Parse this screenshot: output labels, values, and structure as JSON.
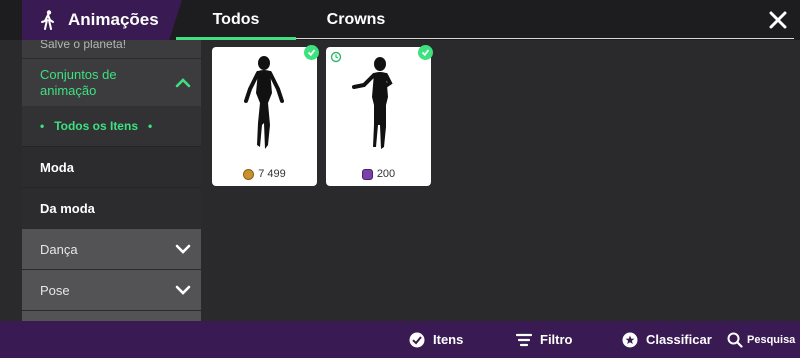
{
  "header": {
    "title": "Animações",
    "title_icon": "walking-person-icon",
    "tabs": [
      {
        "label": "Todos",
        "active": true
      },
      {
        "label": "Crowns",
        "active": false
      }
    ],
    "close_icon": "close-icon",
    "accent_color": "#3ee07f",
    "brand_color": "#3a1a52"
  },
  "sidebar": {
    "partial_top_label": "Salve o planeta!",
    "group": {
      "label": "Conjuntos de animação",
      "icon": "chevron-up-icon"
    },
    "sub_item": {
      "label": "Todos os Itens"
    },
    "items": [
      {
        "label": "Moda"
      },
      {
        "label": "Da moda"
      }
    ],
    "collapsed": [
      {
        "label": "Dança",
        "icon": "chevron-down-icon"
      },
      {
        "label": "Pose",
        "icon": "chevron-down-icon"
      }
    ]
  },
  "cards": [
    {
      "price": "7 499",
      "currency": "kudos-coin-icon",
      "owned": true,
      "badge": null
    },
    {
      "price": "200",
      "currency": "crown-gem-icon",
      "owned": true,
      "badge": "emote-badge-icon"
    }
  ],
  "bottombar": {
    "items_label": "Itens",
    "filter_label": "Filtro",
    "sort_label": "Classificar",
    "search_label": "Pesquisa"
  }
}
